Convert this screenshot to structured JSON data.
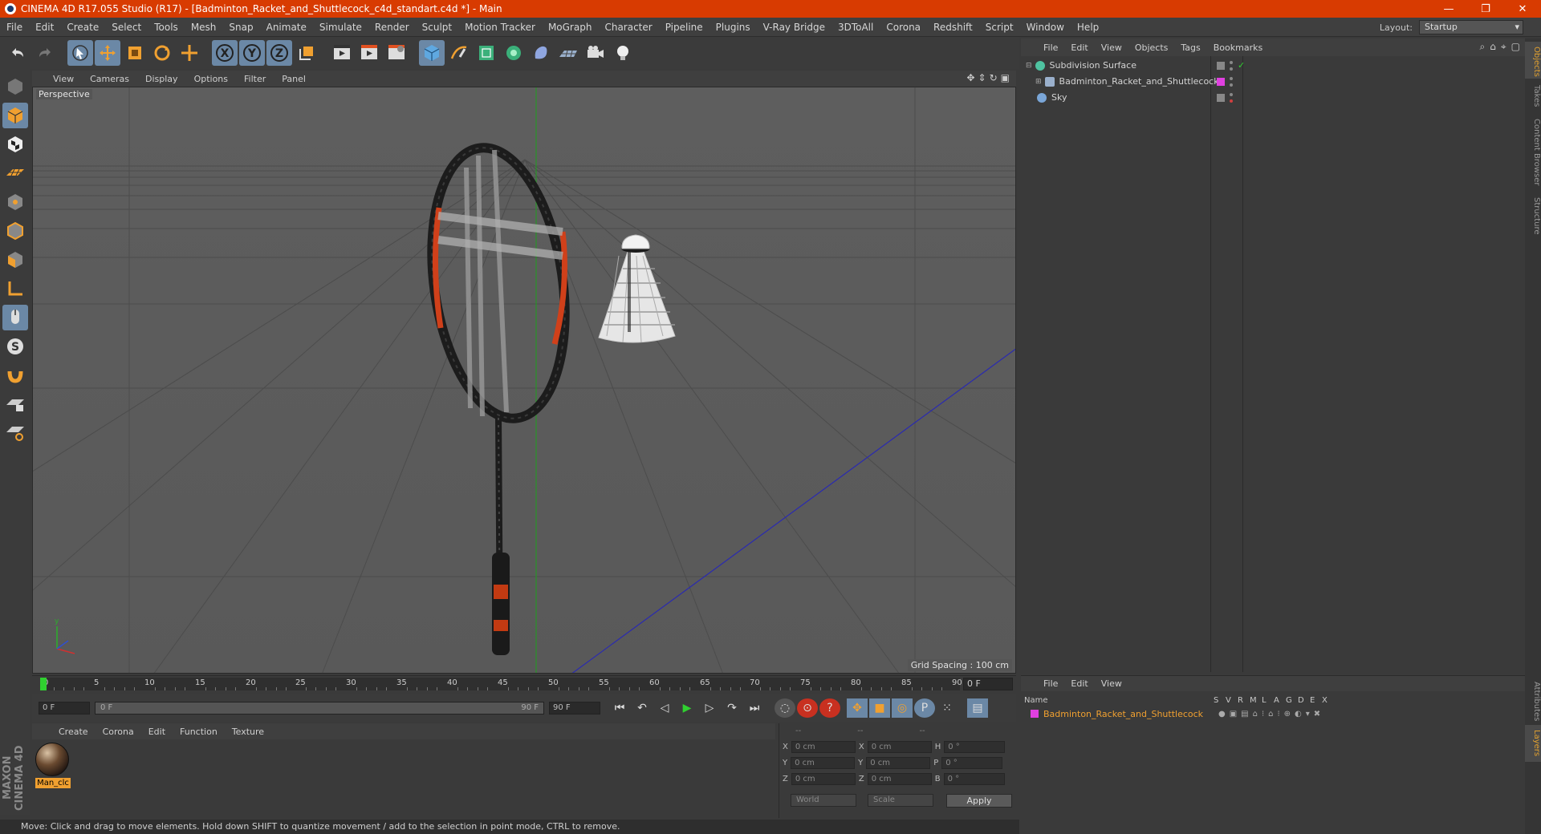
{
  "app": {
    "title": "CINEMA 4D R17.055 Studio (R17) - [Badminton_Racket_and_Shuttlecock_c4d_standart.c4d *] - Main",
    "window_controls": [
      "—",
      "❐",
      "✕"
    ]
  },
  "menu": [
    "File",
    "Edit",
    "Create",
    "Select",
    "Tools",
    "Mesh",
    "Snap",
    "Animate",
    "Simulate",
    "Render",
    "Sculpt",
    "Motion Tracker",
    "MoGraph",
    "Character",
    "Pipeline",
    "Plugins",
    "V-Ray Bridge",
    "3DToAll",
    "Corona",
    "Redshift",
    "Script",
    "Window",
    "Help"
  ],
  "layout": {
    "label": "Layout:",
    "value": "Startup"
  },
  "viewport": {
    "menu": [
      "View",
      "Cameras",
      "Display",
      "Options",
      "Filter",
      "Panel"
    ],
    "label": "Perspective",
    "grid_spacing": "Grid Spacing : 100 cm"
  },
  "timeline": {
    "ticks": [
      "0",
      "5",
      "10",
      "15",
      "20",
      "25",
      "30",
      "35",
      "40",
      "45",
      "50",
      "55",
      "60",
      "65",
      "70",
      "75",
      "80",
      "85",
      "90"
    ],
    "current_frame": "0 F",
    "start_field": "0 F",
    "range_start": "0 F",
    "range_end": "90 F",
    "end_field": "90 F"
  },
  "materials": {
    "menu": [
      "Create",
      "Corona",
      "Edit",
      "Function",
      "Texture"
    ],
    "items": [
      {
        "name": "Man_clc"
      }
    ]
  },
  "coords": {
    "headers": [
      "--",
      "--",
      "--"
    ],
    "rows": [
      {
        "a": "X",
        "av": "0 cm",
        "b": "X",
        "bv": "0 cm",
        "c": "H",
        "cv": "0 °"
      },
      {
        "a": "Y",
        "av": "0 cm",
        "b": "Y",
        "bv": "0 cm",
        "c": "P",
        "cv": "0 °"
      },
      {
        "a": "Z",
        "av": "0 cm",
        "b": "Z",
        "bv": "0 cm",
        "c": "B",
        "cv": "0 °"
      }
    ],
    "world": "World",
    "scale": "Scale",
    "apply": "Apply"
  },
  "status": "Move: Click and drag to move elements. Hold down SHIFT to quantize movement / add to the selection in point mode, CTRL to remove.",
  "objects": {
    "menu": [
      "File",
      "Edit",
      "View",
      "Objects",
      "Tags",
      "Bookmarks"
    ],
    "items": [
      {
        "name": "Subdivision Surface",
        "icon_color": "#4fc3a1"
      },
      {
        "name": "Badminton_Racket_and_Shuttlecock",
        "icon_color": "#9ab0cc",
        "tag_color": "#e040e0"
      },
      {
        "name": "Sky",
        "icon_color": "#7aa6d8"
      }
    ]
  },
  "right_tabs": [
    "Objects",
    "Takes",
    "Content Browser",
    "Structure"
  ],
  "right_tabs_lower": [
    "Attributes",
    "Layers"
  ],
  "layers": {
    "menu": [
      "File",
      "Edit",
      "View"
    ],
    "header_name": "Name",
    "header_cols": [
      "S",
      "V",
      "R",
      "M",
      "L",
      "A",
      "G",
      "D",
      "E",
      "X"
    ],
    "row_name": "Badminton_Racket_and_Shuttlecock",
    "row_color": "#e040e0"
  },
  "logo": "MAXON CINEMA 4D",
  "colors": {
    "title_bar": "#d83b01",
    "accent": "#f0a030",
    "active_tool": "#6b88a6"
  }
}
